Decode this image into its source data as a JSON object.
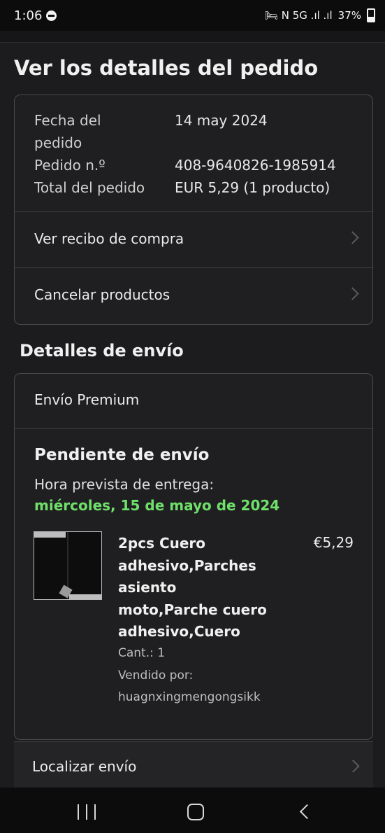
{
  "status_bar": {
    "time": "1:06",
    "indicators": "🛏 N 5G .ıl .ıl",
    "battery": "37%"
  },
  "page": {
    "title": "Ver los detalles del pedido"
  },
  "order_summary": {
    "date_label": "Fecha del",
    "date_label_2": "pedido",
    "date_value": "14 may 2024",
    "order_no_label": "Pedido n.º",
    "order_no_value": "408-9640826-1985914",
    "total_label": "Total del pedido",
    "total_value": "EUR 5,29 (1 producto)",
    "links": [
      {
        "label": "Ver recibo de compra"
      },
      {
        "label": "Cancelar productos"
      }
    ]
  },
  "shipping": {
    "section_title": "Detalles de envío",
    "method": "Envío Premium",
    "status": "Pendiente de envío",
    "eta_label": "Hora prevista de entrega:",
    "eta_date": "miércoles, 15 de mayo de 2024",
    "eta_color": "#6fe06a",
    "item": {
      "title_lines": [
        "2pcs Cuero",
        "adhesivo,Parches",
        "asiento",
        "moto,Parche cuero",
        "adhesivo,Cuero"
      ],
      "price": "€5,29",
      "quantity": "Cant.: 1",
      "sold_by_label": "Vendido por:",
      "seller": "huagnxingmengongsikk"
    },
    "track_label": "Localizar envío"
  }
}
